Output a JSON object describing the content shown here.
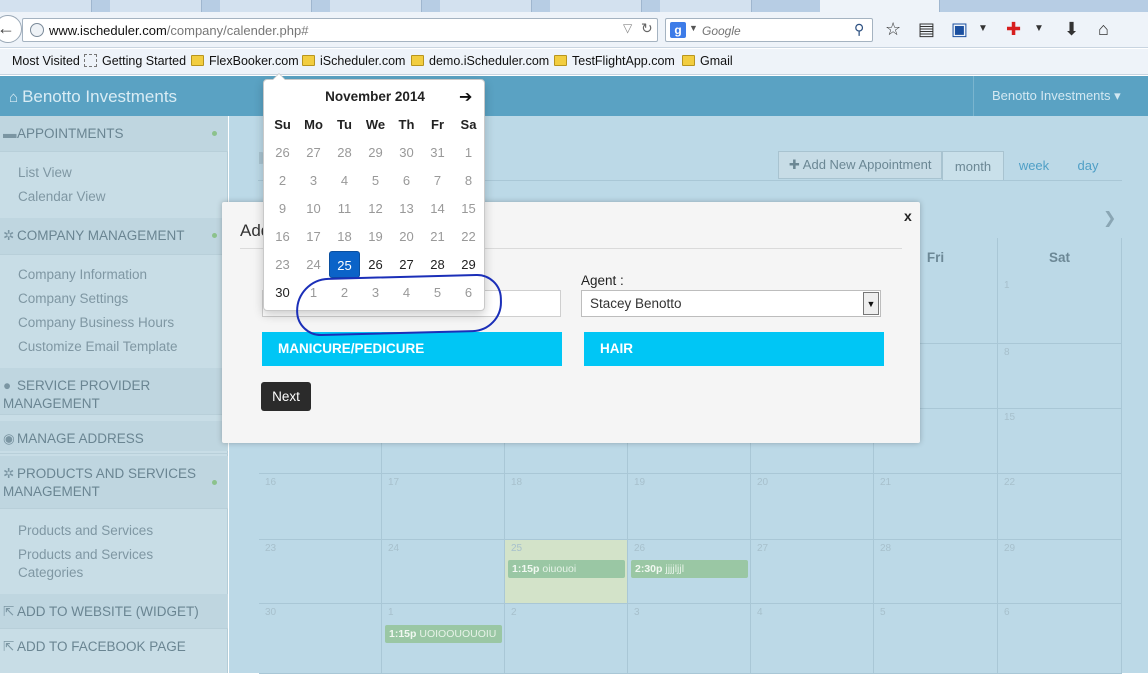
{
  "browser": {
    "url_domain": "www.ischeduler.com",
    "url_path": "/company/calender.php#",
    "search_placeholder": "Google",
    "bookmarks": [
      "Most Visited",
      "Getting Started",
      "FlexBooker.com",
      "iScheduler.com",
      "demo.iScheduler.com",
      "TestFlightApp.com",
      "Gmail"
    ]
  },
  "header": {
    "brand": "Benotto Investments",
    "user_menu": "Benotto Investments ▾"
  },
  "sidebar": {
    "sections": {
      "appointments": "APPOINTMENTS",
      "company_management": "COMPANY MANAGEMENT",
      "service_provider_1": "SERVICE PROVIDER",
      "service_provider_2": "MANAGEMENT",
      "manage_address": "MANAGE ADDRESS",
      "products_1": "PRODUCTS AND SERVICES",
      "products_2": "MANAGEMENT",
      "add_to_website": "ADD TO WEBSITE (WIDGET)",
      "add_to_facebook": "ADD TO FACEBOOK PAGE"
    },
    "items": {
      "list_view": "List View",
      "calendar_view": "Calendar View",
      "company_information": "Company Information",
      "company_settings": "Company Settings",
      "company_business_hours": "Company Business Hours",
      "customize_email": "Customize Email Template",
      "products_services": "Products and Services",
      "products_services_categories_1": "Products and Services",
      "products_services_categories_2": "Categories"
    }
  },
  "calendar": {
    "add_button": "Add New Appointment",
    "views": {
      "month": "month",
      "week": "week",
      "day": "day"
    },
    "visible_headers": {
      "fri": "Fri",
      "sat": "Sat"
    },
    "cells": {
      "r1_sat": "1",
      "r2_sat": "8",
      "r3_sat": "15",
      "r4": [
        "16",
        "17",
        "18",
        "19",
        "20",
        "21",
        "22"
      ],
      "r5": [
        "23",
        "24",
        "25",
        "26",
        "27",
        "28",
        "29"
      ],
      "r6": [
        "30",
        "1",
        "2",
        "3",
        "4",
        "5",
        "6"
      ]
    },
    "events": [
      {
        "time": "1:15p",
        "title": "oiuouoi"
      },
      {
        "time": "2:30p",
        "title": "jjjjljjl"
      },
      {
        "time": "1:15p",
        "title": "UOIOOUOUOIU"
      }
    ]
  },
  "modal": {
    "title": "Add",
    "close": "x",
    "agent_label": "Agent :",
    "agent_value": "Stacey Benotto",
    "service_1": "MANICURE/PEDICURE",
    "service_2": "HAIR",
    "next": "Next"
  },
  "datepicker": {
    "month_label": "November 2014",
    "next_arrow": "➔",
    "dow": [
      "Su",
      "Mo",
      "Tu",
      "We",
      "Th",
      "Fr",
      "Sa"
    ],
    "weeks": [
      [
        "26",
        "27",
        "28",
        "29",
        "30",
        "31",
        "1"
      ],
      [
        "2",
        "3",
        "4",
        "5",
        "6",
        "7",
        "8"
      ],
      [
        "9",
        "10",
        "11",
        "12",
        "13",
        "14",
        "15"
      ],
      [
        "16",
        "17",
        "18",
        "19",
        "20",
        "21",
        "22"
      ],
      [
        "23",
        "24",
        "25",
        "26",
        "27",
        "28",
        "29"
      ],
      [
        "30",
        "1",
        "2",
        "3",
        "4",
        "5",
        "6"
      ]
    ],
    "selected": "25"
  },
  "colors": {
    "header": "#5aa2c3",
    "service_button": "#00c6f5",
    "selected_day": "#0b63c8",
    "annotation": "#1b2fb8"
  }
}
